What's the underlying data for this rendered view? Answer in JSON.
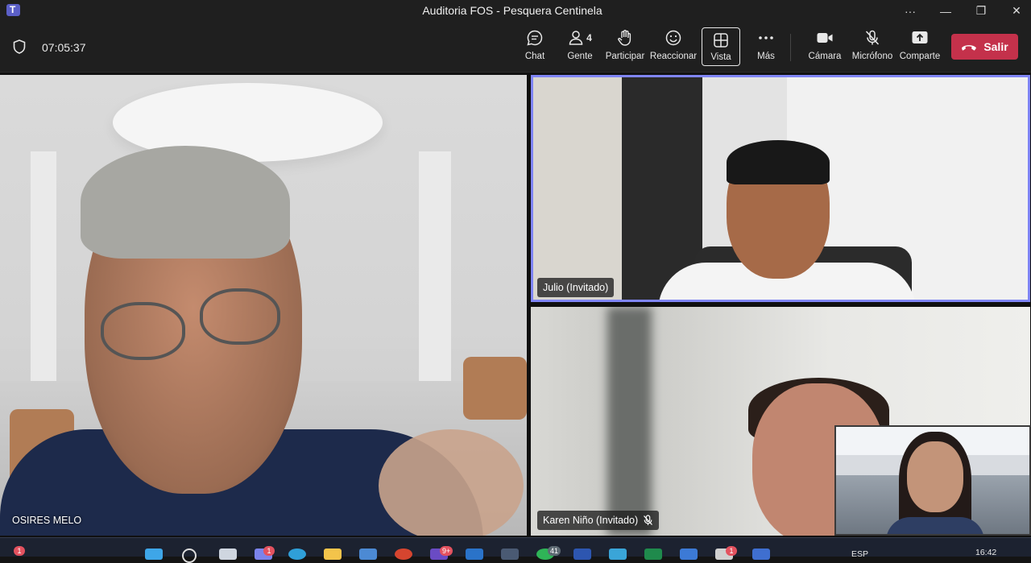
{
  "window": {
    "title": "Auditoria FOS - Pesquera Centinela",
    "controls": [
      "···",
      "—",
      "❐",
      "✕"
    ]
  },
  "meeting": {
    "elapsed_time": "07:05:37"
  },
  "toolbar": {
    "chat_label": "Chat",
    "people_label": "Gente",
    "people_count": "4",
    "raise_hand_label": "Participar",
    "react_label": "Reaccionar",
    "view_label": "Vista",
    "more_label": "Más",
    "camera_label": "Cámara",
    "mic_label": "Micrófono",
    "share_label": "Comparte",
    "leave_label": "Salir"
  },
  "participants": [
    {
      "name": "OSIRES MELO"
    },
    {
      "name": "Julio (Invitado)"
    },
    {
      "name": "Karen Niño (Invitado)"
    }
  ],
  "taskbar": {
    "badges": [
      "1",
      "1",
      "9+",
      "41",
      "1"
    ],
    "language": "ESP",
    "clock": "16:42"
  },
  "colors": {
    "leave": "#c4314b",
    "active_speaker_border": "#7f85f5",
    "toolbar_bg": "#1f1f1f"
  }
}
